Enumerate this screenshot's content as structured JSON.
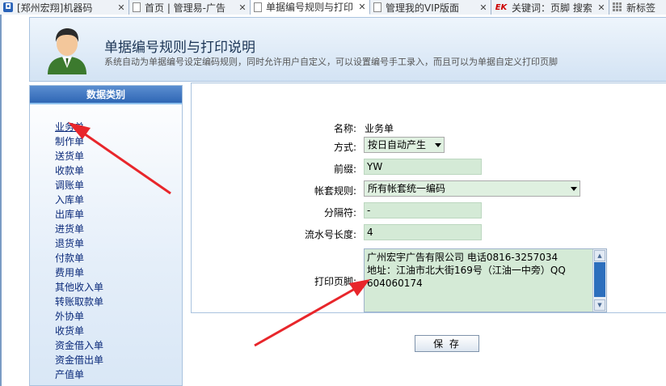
{
  "tabs": [
    {
      "label": "[郑州宏翔]机器码",
      "icon": "app-icon",
      "active": false
    },
    {
      "label": "首页 | 管理易-广告",
      "icon": "page-icon",
      "active": false
    },
    {
      "label": "单据编号规则与打印",
      "icon": "page-icon",
      "active": true
    },
    {
      "label": "管理我的VIP版面",
      "icon": "page-icon",
      "active": false
    },
    {
      "label": "关键词：页脚 搜索",
      "icon": "ek-icon",
      "active": false
    },
    {
      "label": "新标签",
      "icon": "grid-icon",
      "active": false
    }
  ],
  "header": {
    "title": "单据编号规则与打印说明",
    "subtitle": "系统自动为单据编号设定编码规则，同时允许用户自定义，可以设置编号手工录入，而且可以为单据自定义打印页脚"
  },
  "sidebar": {
    "title": "数据类别",
    "items": [
      "业务单",
      "制作单",
      "送货单",
      "收款单",
      "调账单",
      "入库单",
      "出库单",
      "进货单",
      "退货单",
      "付款单",
      "费用单",
      "其他收入单",
      "转账取款单",
      "外协单",
      "收货单",
      "资金借入单",
      "资金借出单",
      "产值单"
    ]
  },
  "form": {
    "name_label": "名称:",
    "name_value": "业务单",
    "method_label": "方式:",
    "method_value": "按日自动产生",
    "prefix_label": "前缀:",
    "prefix_value": "YW",
    "ledger_label": "帐套规则:",
    "ledger_value": "所有帐套统一编码",
    "separator_label": "分隔符:",
    "separator_value": "-",
    "serial_label": "流水号长度:",
    "serial_value": "4",
    "footer_label": "打印页脚:",
    "footer_lines": [
      "广州宏宇广告有限公司       电话0816-3257034",
      "地址：江油市北大街169号（江油一中旁）QQ",
      "604060174"
    ]
  },
  "save_label": "保 存",
  "colors": {
    "arrow": "#e8262b",
    "sidebar_header": "#2f66b4",
    "field_bg": "#d4ead6"
  }
}
